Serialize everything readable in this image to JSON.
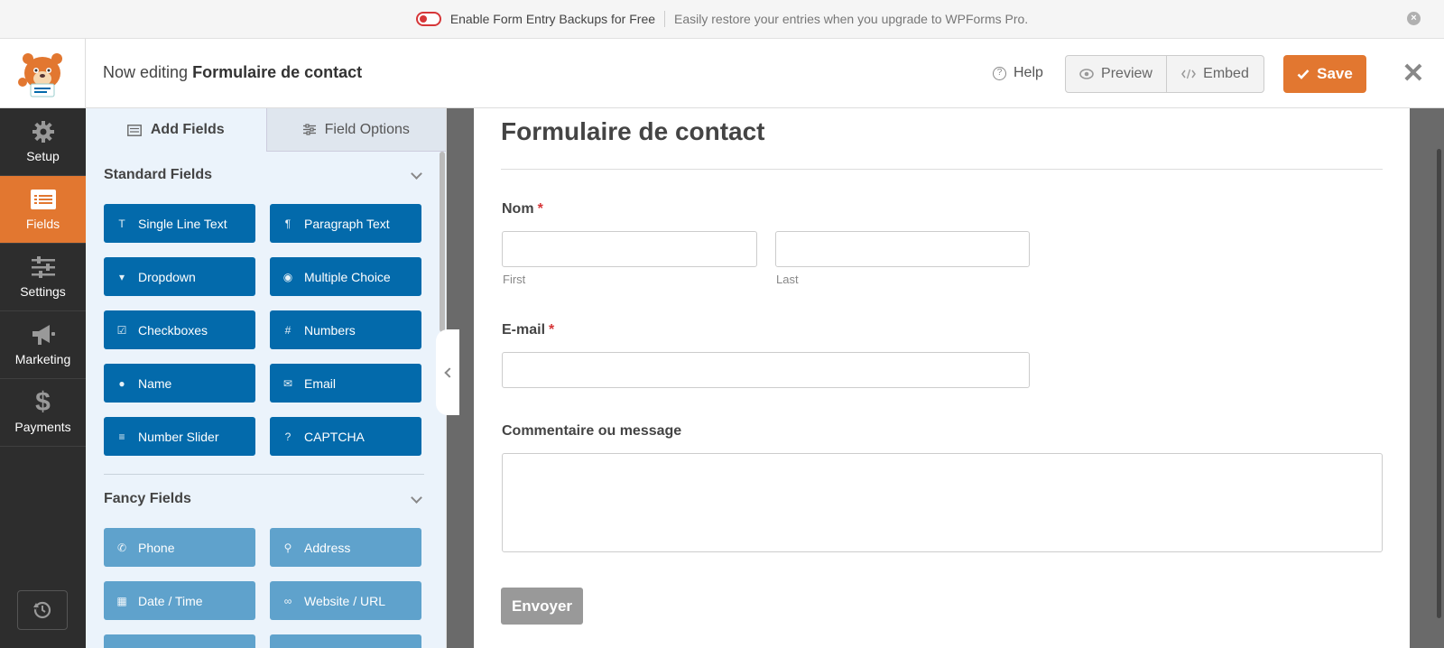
{
  "notice": {
    "toggle_label": "Enable Form Entry Backups for Free",
    "message": "Easily restore your entries when you upgrade to WPForms Pro."
  },
  "header": {
    "editing_prefix": "Now editing",
    "form_name": "Formulaire de contact",
    "help_label": "Help",
    "preview_label": "Preview",
    "embed_label": "Embed",
    "save_label": "Save"
  },
  "sidebar": {
    "items": [
      {
        "label": "Setup",
        "icon": "gear-icon"
      },
      {
        "label": "Fields",
        "icon": "fields-icon",
        "active": true
      },
      {
        "label": "Settings",
        "icon": "sliders-icon"
      },
      {
        "label": "Marketing",
        "icon": "megaphone-icon"
      },
      {
        "label": "Payments",
        "icon": "dollar-icon"
      }
    ]
  },
  "panel": {
    "tabs": {
      "add_fields": "Add Fields",
      "field_options": "Field Options"
    },
    "standard": {
      "heading": "Standard Fields",
      "buttons": [
        "Single Line Text",
        "Paragraph Text",
        "Dropdown",
        "Multiple Choice",
        "Checkboxes",
        "Numbers",
        "Name",
        "Email",
        "Number Slider",
        "CAPTCHA"
      ]
    },
    "fancy": {
      "heading": "Fancy Fields",
      "buttons": [
        "Phone",
        "Address",
        "Date / Time",
        "Website / URL"
      ]
    }
  },
  "form": {
    "title": "Formulaire de contact",
    "fields": {
      "name_label": "Nom",
      "name_first": "First",
      "name_last": "Last",
      "email_label": "E-mail",
      "message_label": "Commentaire ou message",
      "required_marker": "*"
    },
    "submit_label": "Envoyer"
  },
  "colors": {
    "accent_orange": "#e27730",
    "field_button_blue": "#036aab",
    "fancy_button_blue": "#5fa2cc",
    "sidebar_dark": "#2d2d2d"
  }
}
